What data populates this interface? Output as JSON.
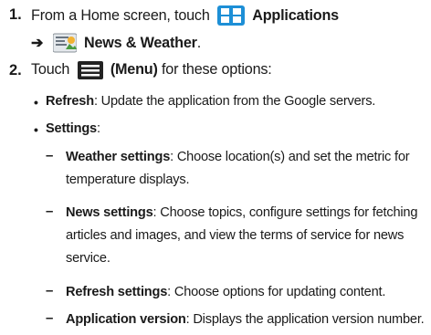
{
  "step1": {
    "number": "1.",
    "text_before": "From a Home screen, touch",
    "apps_label": "Applications",
    "arrow": "➔",
    "news_label": "News & Weather",
    "news_end": "."
  },
  "step2": {
    "number": "2.",
    "touch": "Touch",
    "menu_label": "(Menu)",
    "rest": "for these options:"
  },
  "bullets": [
    {
      "label": "Refresh",
      "text": ": Update the application from the Google servers."
    },
    {
      "label": "Settings",
      "text": ":"
    }
  ],
  "settings": [
    {
      "label": "Weather settings",
      "text": ": Choose location(s) and set the metric for",
      "cont": "temperature displays."
    },
    {
      "label": "News settings",
      "text": ": Choose topics, configure settings for fetching",
      "cont": "articles and images, and view the terms of service for news",
      "cont2": "service."
    },
    {
      "label": "Refresh settings",
      "text": ": Choose options for updating content."
    },
    {
      "label": "Application version",
      "text": ": Displays the application version number."
    }
  ],
  "colors": {
    "apps_icon": "#1d8fd6",
    "menu_icon": "#222222"
  }
}
